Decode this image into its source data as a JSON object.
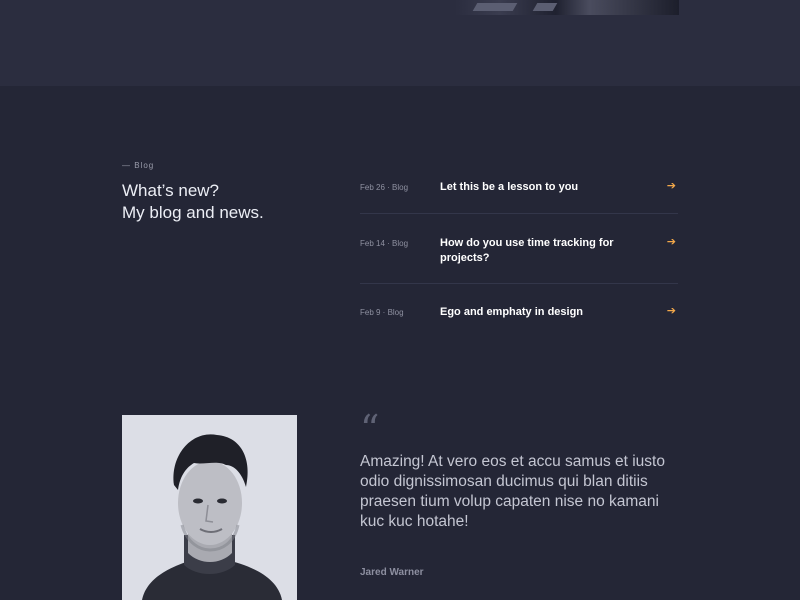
{
  "blog": {
    "eyebrow": "— Blog",
    "title_line1": "What’s new?",
    "title_line2": "My blog and news.",
    "posts": [
      {
        "meta": "Feb 26 · Blog",
        "title": "Let this be a lesson to you",
        "arrow_icon": "arrow-right-icon"
      },
      {
        "meta": "Feb 14 · Blog",
        "title": "How do you use time tracking for projects?",
        "arrow_icon": "arrow-right-icon"
      },
      {
        "meta": "Feb 9 · Blog",
        "title": "Ego and emphaty in design",
        "arrow_icon": "arrow-right-icon"
      }
    ]
  },
  "testimonial": {
    "quote_mark": "“",
    "text": "Amazing! At vero eos et accu samus et iusto odio dignissimosan ducimus qui blan ditiis praesen tium volup capaten nise no kamani kuc kuc hotahe!",
    "author": "Jared Warner"
  },
  "colors": {
    "background": "#242636",
    "top_band": "#2b2d3f",
    "accent_arrow": "#f3a84a",
    "divider": "#33364a"
  }
}
